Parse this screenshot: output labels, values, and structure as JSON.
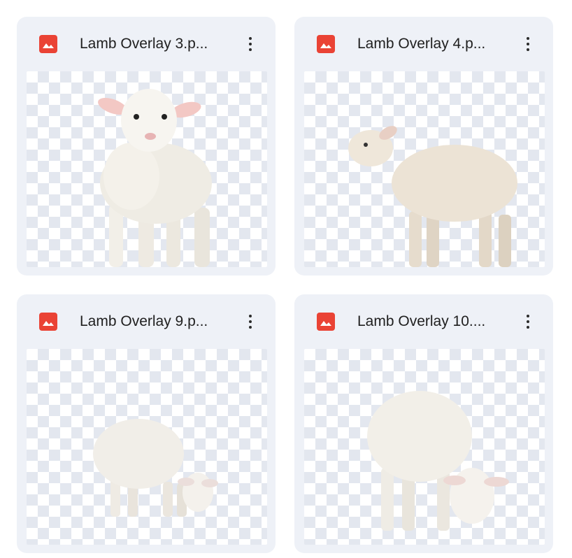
{
  "files": [
    {
      "name": "Lamb Overlay 3.p...",
      "file_type_icon": "image-file-icon",
      "menu_icon": "more-vert-icon",
      "thumbnail": "lamb-standing-facing-viewer"
    },
    {
      "name": "Lamb Overlay 4.p...",
      "file_type_icon": "image-file-icon",
      "menu_icon": "more-vert-icon",
      "thumbnail": "lamb-standing-side-view"
    },
    {
      "name": "Lamb Overlay 9.p...",
      "file_type_icon": "image-file-icon",
      "menu_icon": "more-vert-icon",
      "thumbnail": "lamb-grazing-small"
    },
    {
      "name": "Lamb Overlay 10....",
      "file_type_icon": "image-file-icon",
      "menu_icon": "more-vert-icon",
      "thumbnail": "lamb-grazing-large"
    }
  ],
  "colors": {
    "card_background": "#eef1f7",
    "image_icon": "#ea4335",
    "checker": "#e3e7ef",
    "text": "#1f1f1f"
  }
}
